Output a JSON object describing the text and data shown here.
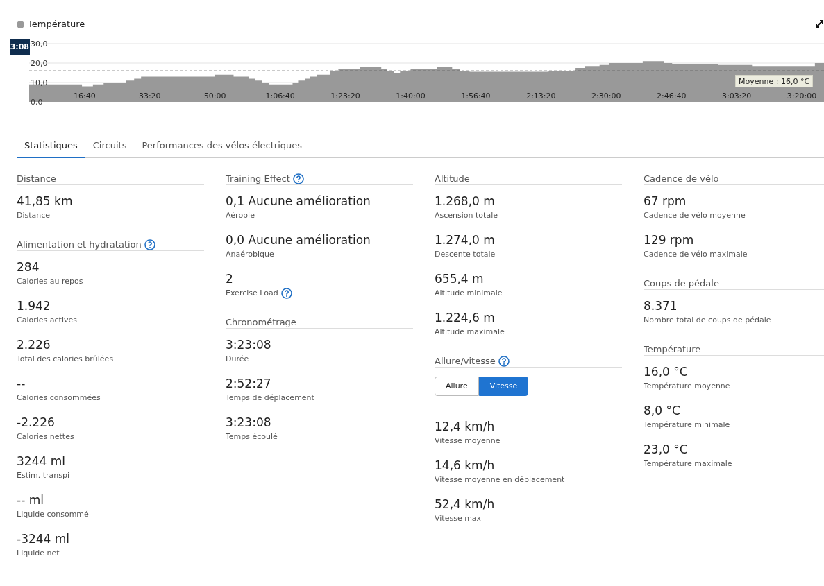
{
  "chart": {
    "cursor_label": "3:08",
    "chart_data": {
      "type": "area",
      "series": [
        {
          "name": "Température",
          "color": "#999999",
          "values": [
            9,
            8,
            9,
            10,
            11,
            12,
            13,
            14,
            13,
            12,
            11,
            10,
            9,
            10,
            11,
            12,
            13,
            14,
            16,
            17,
            18,
            17,
            16,
            15,
            16,
            17,
            17,
            18,
            17,
            16,
            15.5,
            16,
            17.5,
            18.5,
            19,
            20,
            21,
            20,
            19.5,
            19,
            18.5,
            20,
            20
          ]
        }
      ],
      "x": [
        150,
        960,
        1128,
        1292,
        1640,
        1760,
        1866,
        3000,
        3285,
        3515,
        3612,
        3717,
        3825,
        4190,
        4275,
        4380,
        4460,
        4565,
        4766,
        4892,
        5218,
        5550,
        5634,
        5750,
        5838,
        6000,
        6142,
        6410,
        6637,
        6758,
        6904,
        8117,
        8530,
        8673,
        8898,
        9045,
        9560,
        9888,
        10011,
        10712,
        11247,
        12200,
        12340
      ],
      "xlim": [
        150,
        12340
      ],
      "ylim": [
        0,
        30
      ],
      "xticks": [
        {
          "value": 1000,
          "label": "16:40"
        },
        {
          "value": 2000,
          "label": "33:20"
        },
        {
          "value": 3000,
          "label": "50:00"
        },
        {
          "value": 4000,
          "label": "1:06:40"
        },
        {
          "value": 5000,
          "label": "1:23:20"
        },
        {
          "value": 6000,
          "label": "1:40:00"
        },
        {
          "value": 7000,
          "label": "1:56:40"
        },
        {
          "value": 8000,
          "label": "2:13:20"
        },
        {
          "value": 9000,
          "label": "2:30:00"
        },
        {
          "value": 10000,
          "label": "2:46:40"
        },
        {
          "value": 11000,
          "label": "3:03:20"
        },
        {
          "value": 12000,
          "label": "3:20:00"
        }
      ],
      "yticks": [
        {
          "value": 0,
          "label": "0,0"
        },
        {
          "value": 10,
          "label": "10,0"
        },
        {
          "value": 20,
          "label": "20,0"
        },
        {
          "value": 30,
          "label": "30,0"
        }
      ],
      "ref_lines": [
        {
          "axis": "y",
          "value": 16,
          "label": "Moyenne : 16,0 °C"
        }
      ]
    }
  },
  "tabs": [
    {
      "label": "Statistiques",
      "selected": true
    },
    {
      "label": "Circuits",
      "selected": false
    },
    {
      "label": "Performances des vélos électriques",
      "selected": false
    }
  ],
  "columns": [
    {
      "groups": [
        {
          "title": "Distance",
          "help": false,
          "items": [
            {
              "value": "41,85 km",
              "label": "Distance",
              "help": false
            }
          ]
        },
        {
          "title": "Alimentation et hydratation",
          "help": true,
          "items": [
            {
              "value": "284",
              "label": "Calories au repos",
              "help": false
            },
            {
              "value": "1.942",
              "label": "Calories actives",
              "help": false
            },
            {
              "value": "2.226",
              "label": "Total des calories brûlées",
              "help": false
            },
            {
              "value": "--",
              "label": "Calories consommées",
              "help": false
            },
            {
              "value": "-2.226",
              "label": "Calories nettes",
              "help": false
            },
            {
              "value": "3244 ml",
              "label": "Estim. transpi",
              "help": false
            },
            {
              "value": "-- ml",
              "label": "Liquide consommé",
              "help": false
            },
            {
              "value": "-3244 ml",
              "label": "Liquide net",
              "help": false
            }
          ]
        }
      ]
    },
    {
      "groups": [
        {
          "title": "Training Effect",
          "help": true,
          "items": [
            {
              "value": "0,1 Aucune amélioration",
              "label": "Aérobie",
              "help": false
            },
            {
              "value": "0,0 Aucune amélioration",
              "label": "Anaérobique",
              "help": false
            },
            {
              "value": "2",
              "label": "Exercise Load",
              "help": true
            }
          ]
        },
        {
          "title": "Chronométrage",
          "help": false,
          "items": [
            {
              "value": "3:23:08",
              "label": "Durée",
              "help": false
            },
            {
              "value": "2:52:27",
              "label": "Temps de déplacement",
              "help": false
            },
            {
              "value": "3:23:08",
              "label": "Temps écoulé",
              "help": false
            }
          ]
        }
      ]
    },
    {
      "groups": [
        {
          "title": "Altitude",
          "help": false,
          "items": [
            {
              "value": "1.268,0 m",
              "label": "Ascension totale",
              "help": false
            },
            {
              "value": "1.274,0 m",
              "label": "Descente totale",
              "help": false
            },
            {
              "value": "655,4 m",
              "label": "Altitude minimale",
              "help": false
            },
            {
              "value": "1.224,6 m",
              "label": "Altitude maximale",
              "help": false
            }
          ]
        },
        {
          "title": "Allure/vitesse",
          "help": true,
          "toggle": [
            {
              "label": "Allure",
              "selected": false
            },
            {
              "label": "Vitesse",
              "selected": true
            }
          ],
          "items": [
            {
              "value": "12,4 km/h",
              "label": "Vitesse moyenne",
              "help": false
            },
            {
              "value": "14,6 km/h",
              "label": "Vitesse moyenne en déplacement",
              "help": false
            },
            {
              "value": "52,4 km/h",
              "label": "Vitesse max",
              "help": false
            }
          ]
        }
      ]
    },
    {
      "groups": [
        {
          "title": "Cadence de vélo",
          "help": false,
          "items": [
            {
              "value": "67 rpm",
              "label": "Cadence de vélo moyenne",
              "help": false
            },
            {
              "value": "129 rpm",
              "label": "Cadence de vélo maximale",
              "help": false
            }
          ]
        },
        {
          "title": "Coups de pédale",
          "help": false,
          "items": [
            {
              "value": "8.371",
              "label": "Nombre total de coups de pédale",
              "help": false
            }
          ]
        },
        {
          "title": "Température",
          "help": false,
          "items": [
            {
              "value": "16,0 °C",
              "label": "Température moyenne",
              "help": false
            },
            {
              "value": "8,0 °C",
              "label": "Température minimale",
              "help": false
            },
            {
              "value": "23,0 °C",
              "label": "Température maximale",
              "help": false
            }
          ]
        }
      ]
    }
  ]
}
